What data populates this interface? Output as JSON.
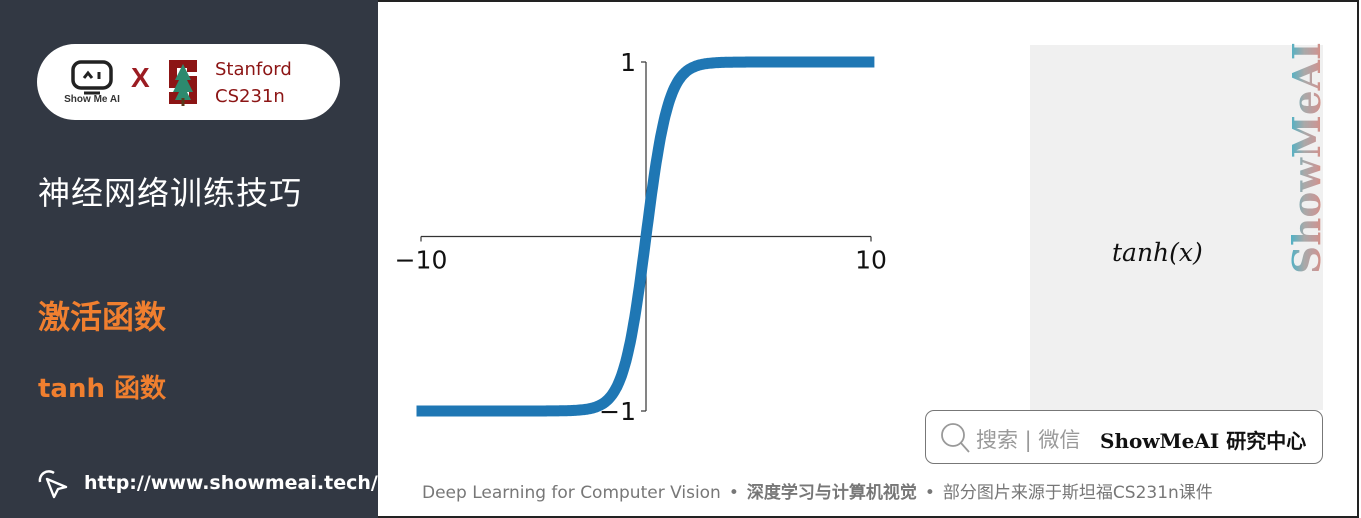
{
  "brand": {
    "showmeai_label": "Show Me AI",
    "times_sign": "X",
    "stanford_line1": "Stanford",
    "stanford_line2": "CS231n"
  },
  "sidebar": {
    "course_title": "神经网络训练技巧",
    "section_title": "激活函数",
    "sub_title": "tanh 函数",
    "url": "http://www.showmeai.tech/"
  },
  "formula_panel": {
    "formula": "tanh(x)",
    "watermark": "ShowMeAI"
  },
  "search_box": {
    "hint": "搜索 | 微信",
    "brand": "ShowMeAI 研究中心"
  },
  "footer": {
    "english": "Deep Learning for Computer Vision",
    "chinese_bold": "深度学习与计算机视觉",
    "credit": "部分图片来源于斯坦福CS231n课件",
    "separator": "•"
  },
  "colors": {
    "sidebar_bg": "#323843",
    "accent_orange": "#f07f2f",
    "stanford_red": "#8c1515",
    "curve_blue": "#1f77b4"
  },
  "chart_data": {
    "type": "line",
    "title": "",
    "function": "tanh(x)",
    "xlabel": "",
    "ylabel": "",
    "xlim": [
      -10,
      10
    ],
    "ylim": [
      -1,
      1
    ],
    "x_ticks": [
      -10,
      10
    ],
    "x_tick_labels": [
      "−10",
      "10"
    ],
    "y_ticks": [
      -1,
      1
    ],
    "y_tick_labels": [
      "−1",
      "1"
    ],
    "grid": false,
    "series": [
      {
        "name": "tanh",
        "x": [
          -10,
          -5,
          -4,
          -3,
          -2.5,
          -2,
          -1.5,
          -1,
          -0.5,
          0,
          0.5,
          1,
          1.5,
          2,
          2.5,
          3,
          4,
          5,
          10
        ],
        "y": [
          -1.0,
          -0.9999,
          -0.9993,
          -0.9951,
          -0.9866,
          -0.964,
          -0.9051,
          -0.7616,
          -0.4621,
          0,
          0.4621,
          0.7616,
          0.9051,
          0.964,
          0.9866,
          0.9951,
          0.9993,
          0.9999,
          1.0
        ]
      }
    ]
  }
}
